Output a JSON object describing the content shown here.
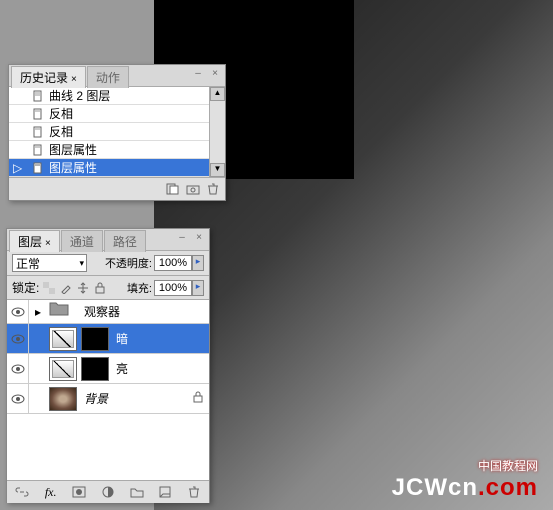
{
  "canvas": {
    "watermark_cn": "中国教程网",
    "watermark_en": "JCWcn",
    "watermark_suffix": ".com"
  },
  "history": {
    "tab1": "历史记录",
    "tab2": "动作",
    "items": [
      {
        "label": "曲线 2 图层"
      },
      {
        "label": "反相"
      },
      {
        "label": "反相"
      },
      {
        "label": "图层属性"
      },
      {
        "label": "图层属性"
      }
    ]
  },
  "layers": {
    "tab1": "图层",
    "tab2": "通道",
    "tab3": "路径",
    "blend_mode": "正常",
    "opacity_label": "不透明度:",
    "opacity_value": "100%",
    "lock_label": "锁定:",
    "fill_label": "填充:",
    "fill_value": "100%",
    "items": [
      {
        "name": "观察器",
        "type": "group"
      },
      {
        "name": "暗",
        "type": "curves"
      },
      {
        "name": "亮",
        "type": "curves"
      },
      {
        "name": "背景",
        "type": "bg"
      }
    ]
  }
}
